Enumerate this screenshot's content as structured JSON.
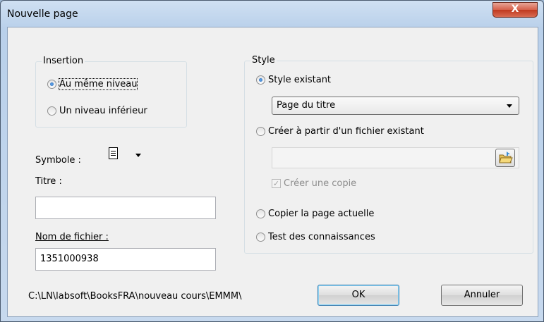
{
  "window": {
    "title": "Nouvelle page",
    "close_glyph": "X"
  },
  "insertion": {
    "legend": "Insertion",
    "options": [
      "Au même niveau",
      "Un niveau inférieur"
    ]
  },
  "symbol": {
    "label": "Symbole :",
    "icon": "document-icon"
  },
  "title_field": {
    "label": "Titre :",
    "value": ""
  },
  "filename": {
    "label": "Nom de fichier :",
    "value": "1351000938"
  },
  "style": {
    "legend": "Style",
    "existing_label": "Style existant",
    "existing_value": "Page du titre",
    "from_file_label": "Créer à partir d'un fichier existant",
    "from_file_value": "",
    "copy_checkbox_label": "Créer une copie",
    "copy_page_label": "Copier la page actuelle",
    "quiz_label": "Test des connaissances"
  },
  "path": "C:\\LN\\labsoft\\BooksFRA\\nouveau cours\\EMMM\\",
  "buttons": {
    "ok": "OK",
    "cancel": "Annuler"
  }
}
